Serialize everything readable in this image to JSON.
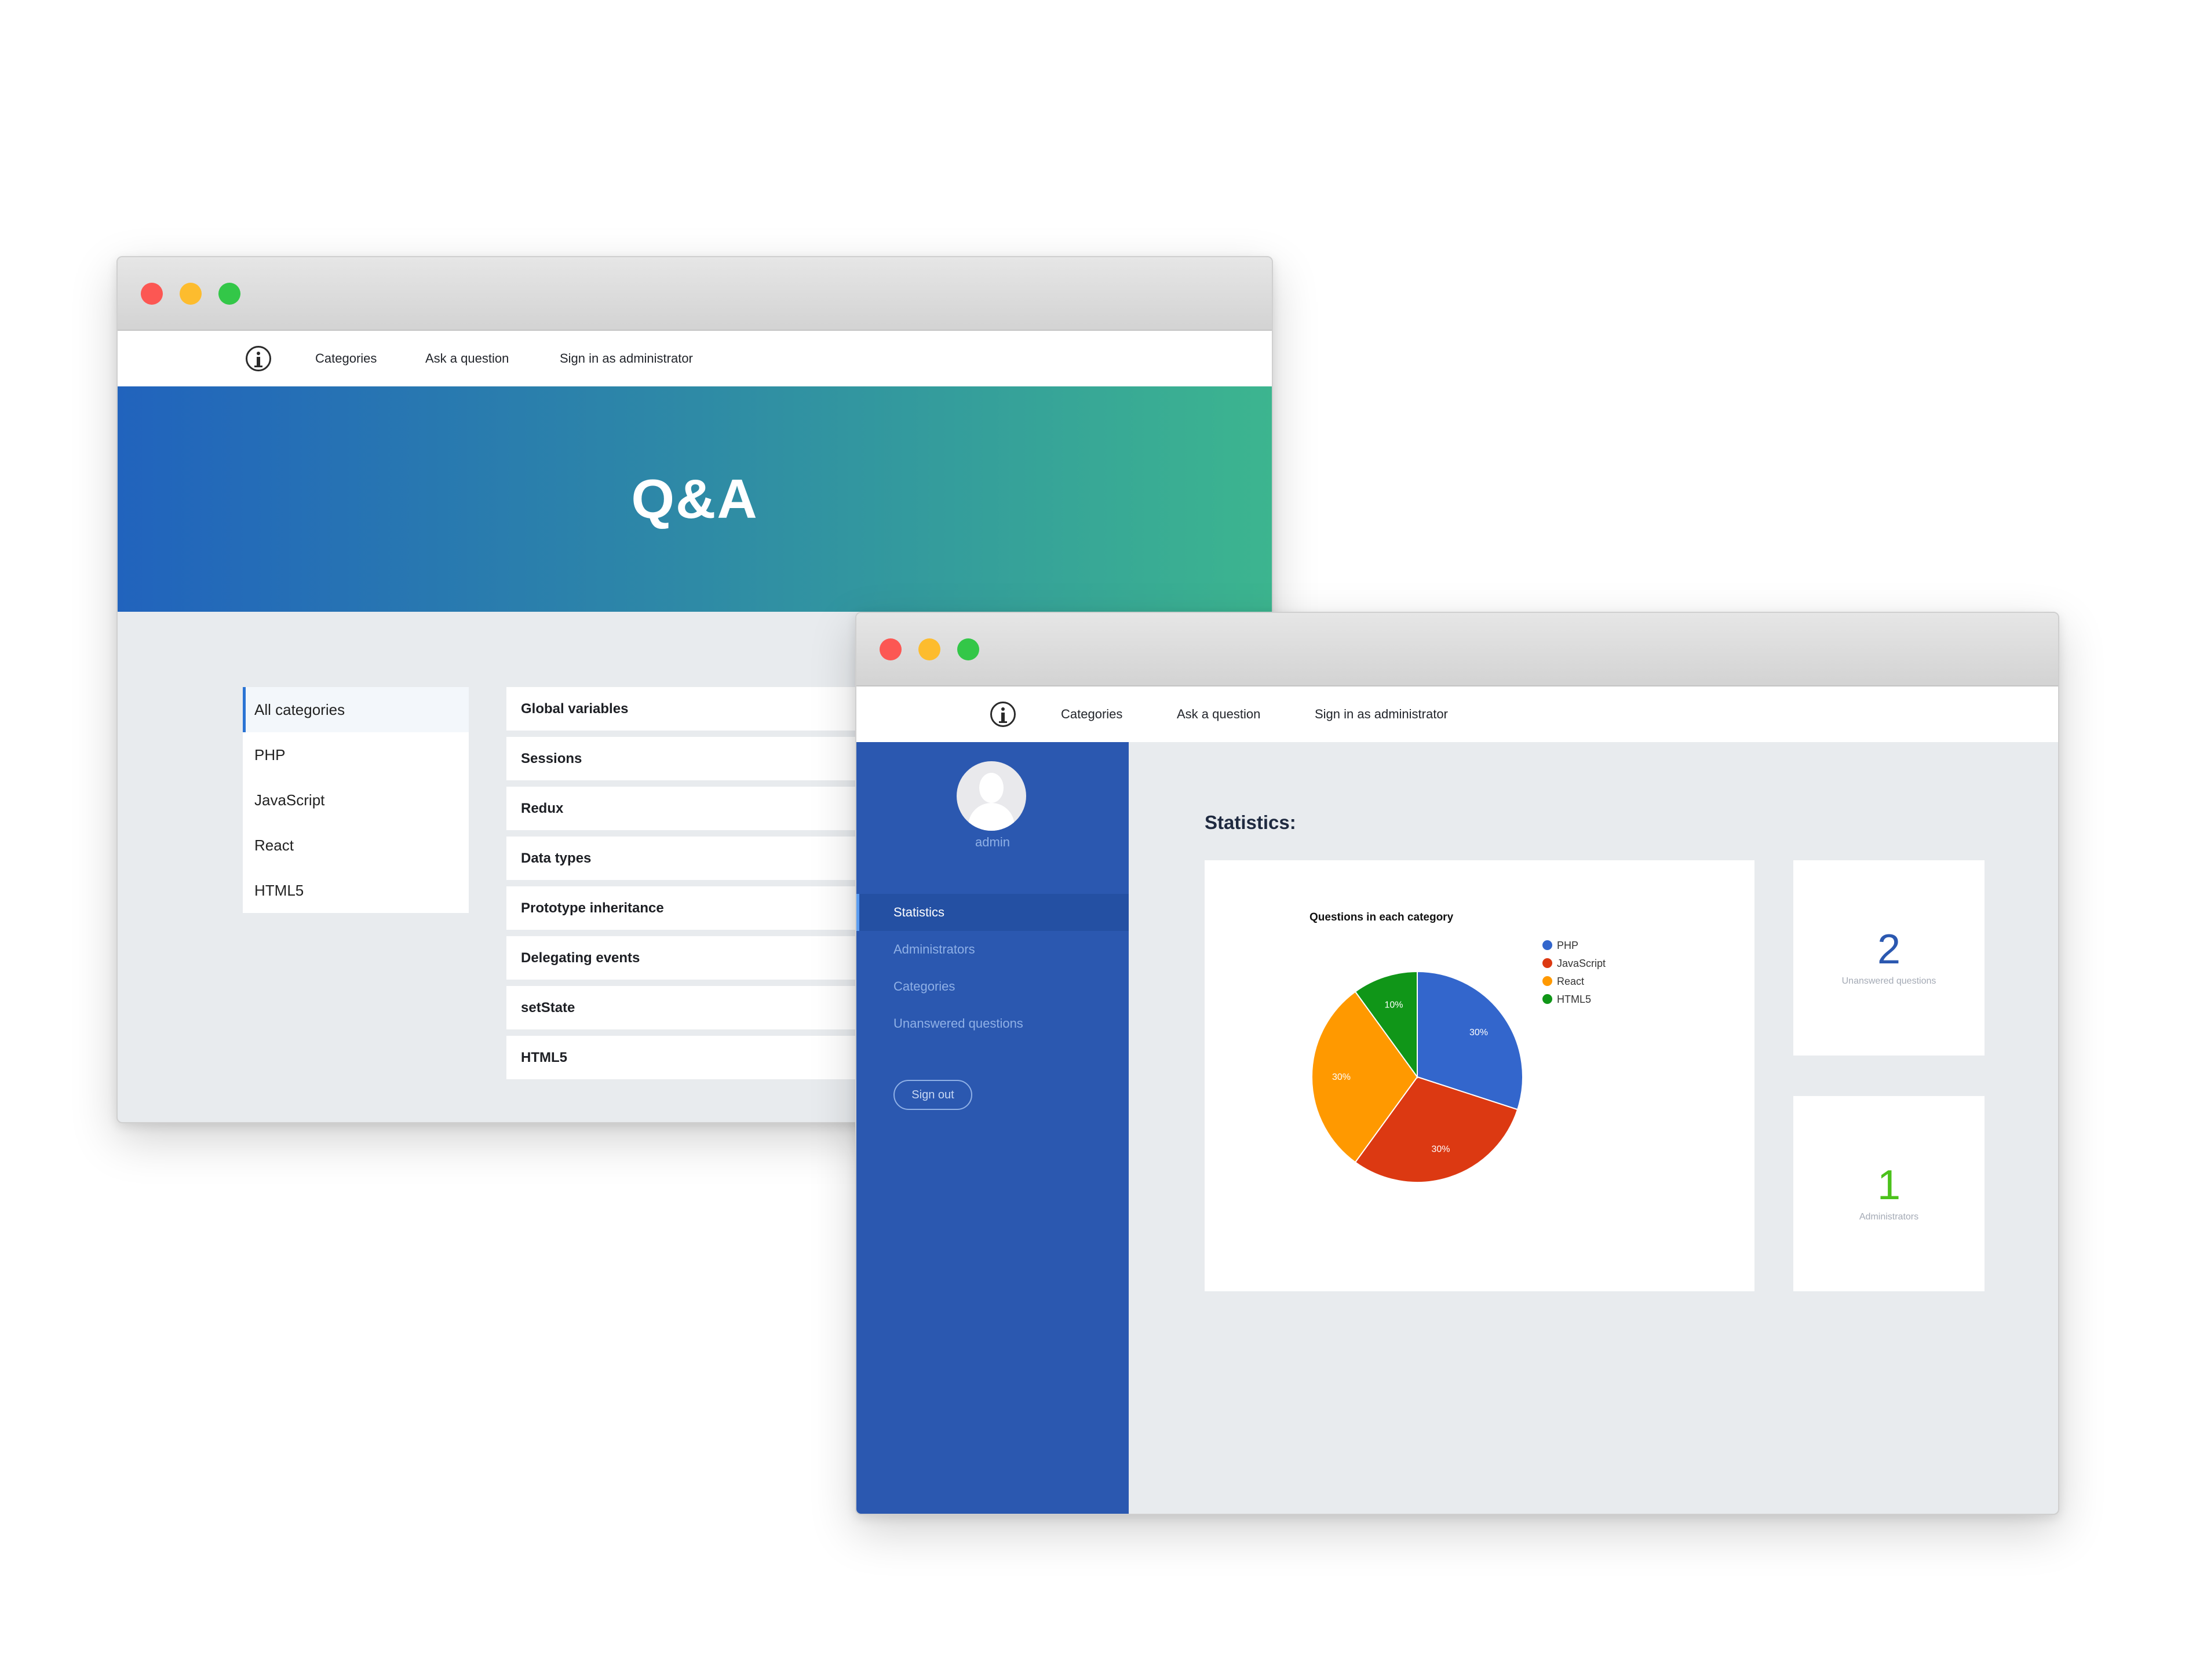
{
  "colors": {
    "hero_gradient_start": "#2163bd",
    "hero_gradient_end": "#3cb58f",
    "sidebar": "#2b58b0",
    "php": "#3366cc",
    "javascript": "#dc3912",
    "react": "#ff9900",
    "html5": "#109618",
    "unanswered_value": "#2b58b0",
    "administrators_value": "#4cc21c"
  },
  "back_window": {
    "nav": {
      "icon": "info-icon",
      "links": [
        "Categories",
        "Ask a question",
        "Sign in as administrator"
      ]
    },
    "hero_title": "Q&A",
    "categories": [
      "All categories",
      "PHP",
      "JavaScript",
      "React",
      "HTML5"
    ],
    "selected_category": "All categories",
    "questions": [
      "Global variables",
      "Sessions",
      "Redux",
      "Data types",
      "Prototype inheritance",
      "Delegating events",
      "setState",
      "HTML5"
    ]
  },
  "front_window": {
    "nav": {
      "icon": "info-icon",
      "links": [
        "Categories",
        "Ask a question",
        "Sign in as administrator"
      ]
    },
    "sidebar": {
      "username": "admin",
      "items": [
        "Statistics",
        "Administrators",
        "Categories",
        "Unanswered questions"
      ],
      "active_item": "Statistics",
      "signout_label": "Sign out"
    },
    "heading": "Statistics:",
    "cards": [
      {
        "value": "2",
        "label": "Unanswered questions"
      },
      {
        "value": "1",
        "label": "Administrators"
      }
    ]
  },
  "chart_data": {
    "type": "pie",
    "title": "Questions in each category",
    "categories": [
      "PHP",
      "JavaScript",
      "React",
      "HTML5"
    ],
    "values": [
      30,
      30,
      30,
      10
    ],
    "value_labels": [
      "30%",
      "30%",
      "30%",
      "10%"
    ],
    "legend_position": "right"
  }
}
